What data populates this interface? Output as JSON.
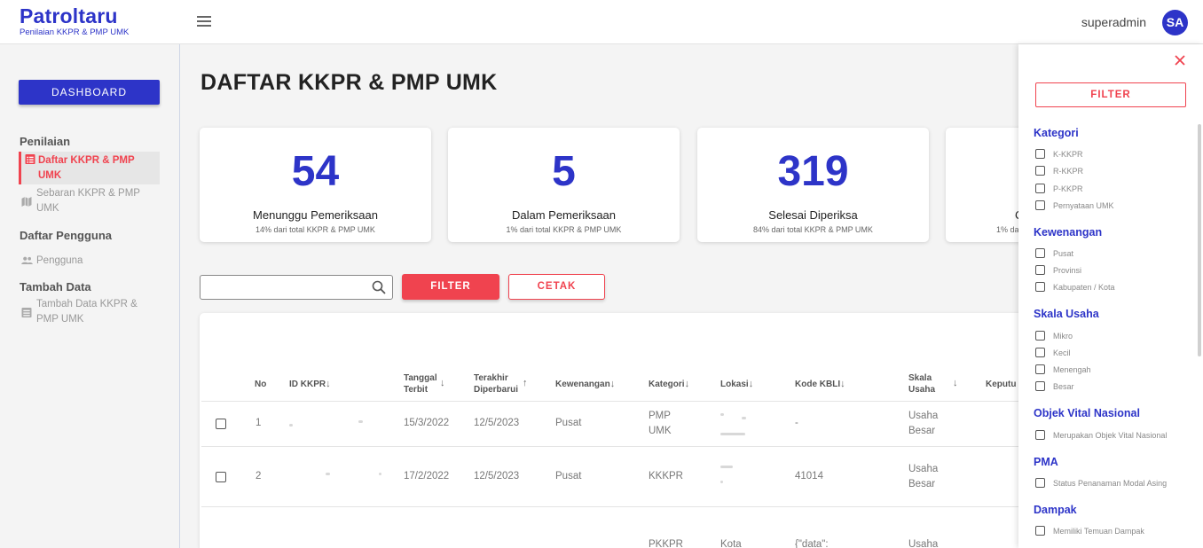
{
  "header": {
    "brand": "Patroltaru",
    "brand_sub": "Penilaian KKPR & PMP UMK",
    "user": "superadmin",
    "avatar": "SA"
  },
  "sidebar": {
    "dashboard": "DASHBOARD",
    "sections": [
      {
        "title": "Penilaian",
        "items": [
          {
            "label": "Daftar KKPR & PMP UMK",
            "icon": "list-icon",
            "active": true
          },
          {
            "label": "Sebaran KKPR & PMP UMK",
            "icon": "map-icon",
            "active": false
          }
        ]
      },
      {
        "title": "Daftar Pengguna",
        "items": [
          {
            "label": "Pengguna",
            "icon": "users-icon",
            "active": false
          }
        ]
      },
      {
        "title": "Tambah Data",
        "items": [
          {
            "label": "Tambah Data KKPR & PMP UMK",
            "icon": "form-icon",
            "active": false
          }
        ]
      }
    ]
  },
  "main": {
    "title": "DAFTAR KKPR & PMP UMK",
    "stats": [
      {
        "value": "54",
        "label": "Menunggu Pemeriksaan",
        "pct": "14% dari total KKPR & PMP UMK"
      },
      {
        "value": "5",
        "label": "Dalam Pemeriksaan",
        "pct": "1% dari total KKPR & PMP UMK"
      },
      {
        "value": "319",
        "label": "Selesai Diperiksa",
        "pct": "84% dari total KKPR & PMP UMK"
      },
      {
        "value": "",
        "label": "C",
        "pct": "1% da"
      }
    ],
    "search_placeholder": "",
    "filter_label": "FILTER",
    "print_label": "CETAK",
    "table": {
      "columns": [
        {
          "l1": "No",
          "l2": "",
          "arrow": ""
        },
        {
          "l1": "ID KKPR",
          "l2": "",
          "arrow": "↓"
        },
        {
          "l1": "Tanggal",
          "l2": "Terbit",
          "arrow": "↓"
        },
        {
          "l1": "Terakhir",
          "l2": "Diperbarui",
          "arrow": "↑"
        },
        {
          "l1": "Kewenangan",
          "l2": "",
          "arrow": "↓"
        },
        {
          "l1": "Kategori",
          "l2": "",
          "arrow": "↓"
        },
        {
          "l1": "Lokasi",
          "l2": "",
          "arrow": "↓"
        },
        {
          "l1": "Kode KBLI",
          "l2": "",
          "arrow": "↓"
        },
        {
          "l1": "Skala",
          "l2": "Usaha",
          "arrow": "↓"
        },
        {
          "l1": "Keputu",
          "l2": "",
          "arrow": ""
        }
      ],
      "rows": [
        {
          "no": "1",
          "tanggal": "15/3/2022",
          "terakhir": "12/5/2023",
          "kewenangan": "Pusat",
          "kategori": "PMP UMK",
          "kbli": "-",
          "skala": "Usaha Besar"
        },
        {
          "no": "2",
          "tanggal": "17/2/2022",
          "terakhir": "12/5/2023",
          "kewenangan": "Pusat",
          "kategori": "KKKPR",
          "kbli": "41014",
          "skala": "Usaha Besar"
        },
        {
          "no": "",
          "tanggal": "",
          "terakhir": "",
          "kewenangan": "",
          "kategori": "PKKPR",
          "lokasi": "Kota",
          "kbli": "{\"data\":",
          "skala": "Usaha"
        }
      ]
    }
  },
  "drawer": {
    "filter_label": "FILTER",
    "groups": [
      {
        "title": "Kategori",
        "options": [
          "K-KKPR",
          "R-KKPR",
          "P-KKPR",
          "Pernyataan UMK"
        ]
      },
      {
        "title": "Kewenangan",
        "options": [
          "Pusat",
          "Provinsi",
          "Kabupaten / Kota"
        ]
      },
      {
        "title": "Skala Usaha",
        "options": [
          "Mikro",
          "Kecil",
          "Menengah",
          "Besar"
        ]
      },
      {
        "title": "Objek Vital Nasional",
        "options": [
          "Merupakan Objek Vital Nasional"
        ]
      },
      {
        "title": "PMA",
        "options": [
          "Status Penanaman Modal Asing"
        ]
      },
      {
        "title": "Dampak",
        "options": [
          "Memiliki Temuan Dampak"
        ]
      }
    ]
  },
  "colors": {
    "primary": "#2d34c8",
    "accent": "#f0434f"
  }
}
